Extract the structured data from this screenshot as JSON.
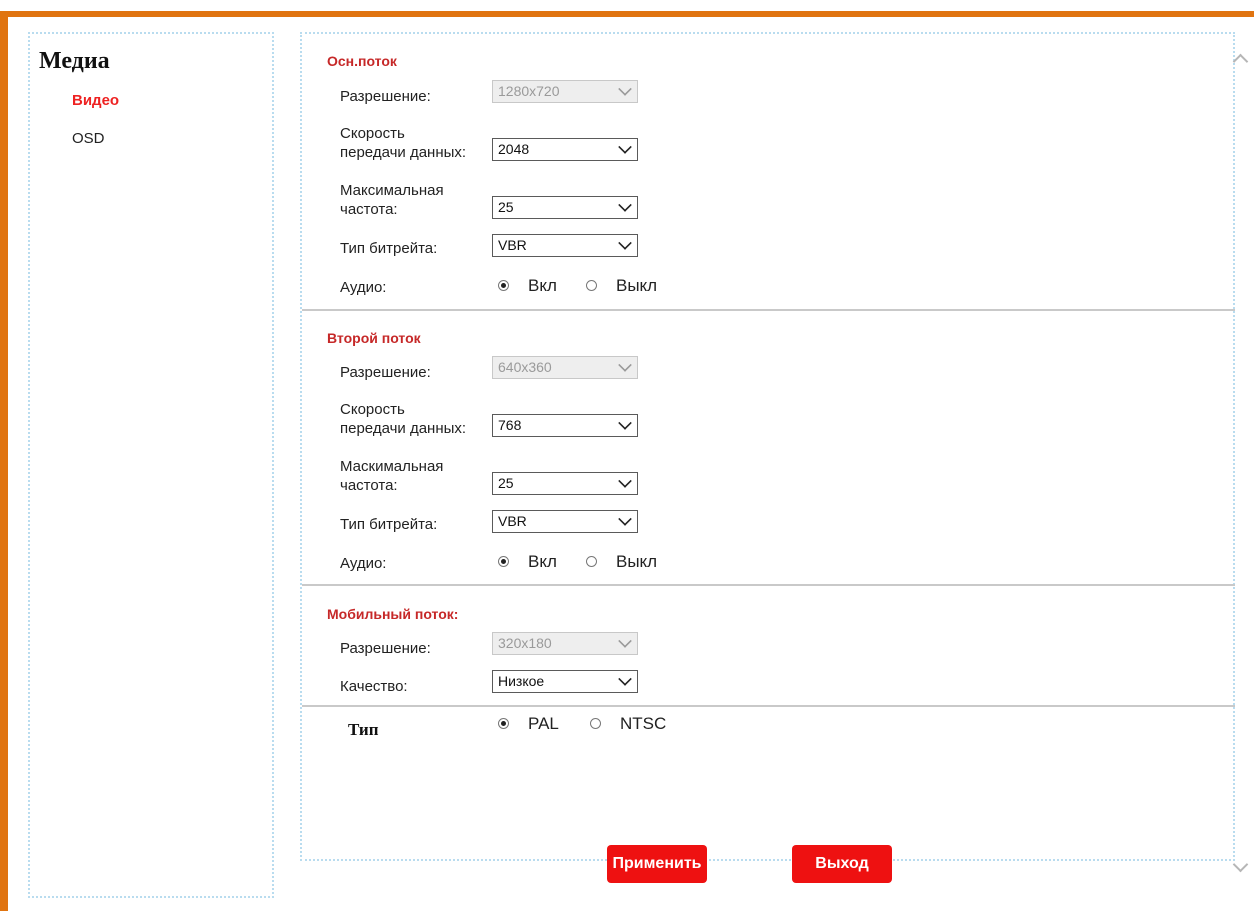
{
  "sidebar": {
    "title": "Медиа",
    "items": [
      {
        "label": "Видео",
        "active": true
      },
      {
        "label": "OSD",
        "active": false
      }
    ]
  },
  "main_stream": {
    "title": "Осн.поток",
    "resolution_label": "Разрешение:",
    "resolution_value": "1280x720",
    "bitrate_label_1": "Скорость",
    "bitrate_label_2": "передачи данных:",
    "bitrate_value": "2048",
    "framerate_label_1": "Максимальная",
    "framerate_label_2": "частота:",
    "framerate_value": "25",
    "bitrate_type_label": "Тип битрейта:",
    "bitrate_type_value": "VBR",
    "audio_label": "Аудио:",
    "audio_on": "Вкл",
    "audio_off": "Выкл",
    "audio_selected": "on"
  },
  "sub_stream": {
    "title": "Второй поток",
    "resolution_label": "Разрешение:",
    "resolution_value": "640x360",
    "bitrate_label_1": "Скорость",
    "bitrate_label_2": "передачи данных:",
    "bitrate_value": "768",
    "framerate_label_1": "Маскимальная",
    "framerate_label_2": "частота:",
    "framerate_value": "25",
    "bitrate_type_label": "Тип битрейта:",
    "bitrate_type_value": "VBR",
    "audio_label": "Аудио:",
    "audio_on": "Вкл",
    "audio_off": "Выкл",
    "audio_selected": "on"
  },
  "mobile_stream": {
    "title": "Мобильный поток:",
    "resolution_label": "Разрешение:",
    "resolution_value": "320x180",
    "quality_label": "Качество:",
    "quality_value": "Низкое"
  },
  "video_type": {
    "label": "Тип",
    "pal": "PAL",
    "ntsc": "NTSC",
    "selected": "PAL"
  },
  "buttons": {
    "apply": "Применить",
    "exit": "Выход"
  },
  "colors": {
    "frame": "#e07410",
    "accent_red": "#ee1111",
    "section_title": "#c62828"
  }
}
